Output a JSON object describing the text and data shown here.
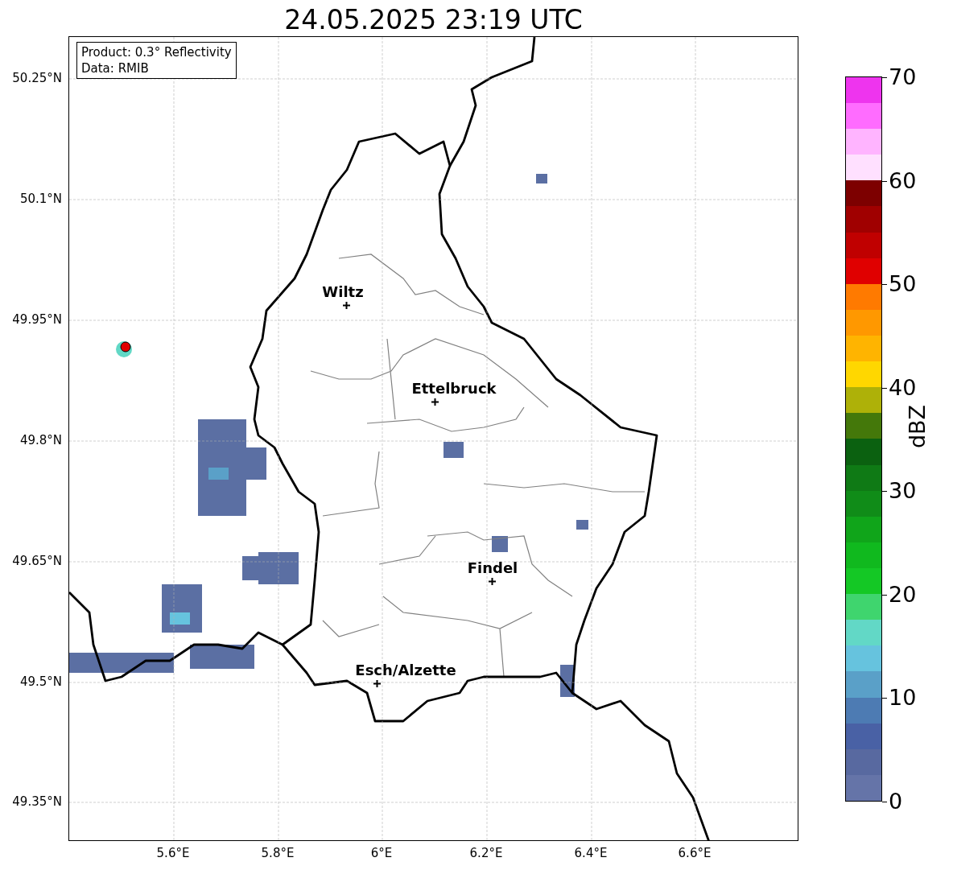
{
  "title": "24.05.2025 23:19 UTC",
  "info_box": [
    "Product: 0.3° Reflectivity",
    "Data: RMIB"
  ],
  "y_ticks": [
    "50.25°N",
    "50.1°N",
    "49.95°N",
    "49.8°N",
    "49.65°N",
    "49.5°N",
    "49.35°N"
  ],
  "x_ticks": [
    "5.6°E",
    "5.8°E",
    "6°E",
    "6.2°E",
    "6.4°E",
    "6.6°E"
  ],
  "cities": [
    {
      "name": "Wiltz"
    },
    {
      "name": "Ettelbruck"
    },
    {
      "name": "Findel"
    },
    {
      "name": "Esch/Alzette"
    }
  ],
  "colorbar": {
    "label": "dBZ",
    "ticks": [
      "70",
      "60",
      "50",
      "40",
      "30",
      "20",
      "10",
      "0"
    ],
    "bands": [
      {
        "color": "#6574a8"
      },
      {
        "color": "#5869a0"
      },
      {
        "color": "#4961a5"
      },
      {
        "color": "#4d7bb3"
      },
      {
        "color": "#5aa0c8"
      },
      {
        "color": "#66c3de"
      },
      {
        "color": "#62d8c6"
      },
      {
        "color": "#3fd56e"
      },
      {
        "color": "#14c825"
      },
      {
        "color": "#10b91e"
      },
      {
        "color": "#10a51a"
      },
      {
        "color": "#108c18"
      },
      {
        "color": "#0f7a15"
      },
      {
        "color": "#0b6110"
      },
      {
        "color": "#44780a"
      },
      {
        "color": "#aeb108"
      },
      {
        "color": "#ffd700"
      },
      {
        "color": "#ffb400"
      },
      {
        "color": "#ff9800"
      },
      {
        "color": "#ff7a00"
      },
      {
        "color": "#e00000"
      },
      {
        "color": "#c00000"
      },
      {
        "color": "#a00000"
      },
      {
        "color": "#7d0000"
      },
      {
        "color": "#ffe0ff"
      },
      {
        "color": "#ffb4ff"
      },
      {
        "color": "#ff6cff"
      },
      {
        "color": "#ee34ee"
      }
    ]
  }
}
